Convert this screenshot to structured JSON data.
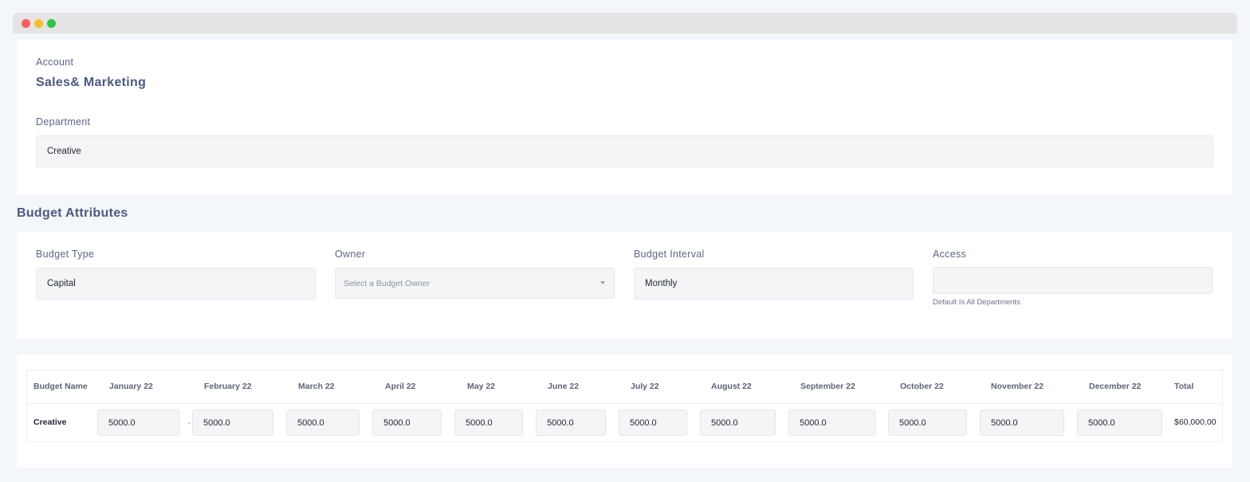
{
  "account": {
    "label": "Account",
    "value": "Sales& Marketing"
  },
  "department": {
    "label": "Department",
    "value": "Creative"
  },
  "section_title": "Budget Attributes",
  "attributes": {
    "budget_type": {
      "label": "Budget Type",
      "value": "Capital"
    },
    "owner": {
      "label": "Owner",
      "placeholder": "Select a Budget Owner"
    },
    "budget_interval": {
      "label": "Budget Interval",
      "value": "Monthly"
    },
    "access": {
      "label": "Access",
      "value": "",
      "hint": "Default Is All Departments"
    }
  },
  "table": {
    "headers": [
      "Budget Name",
      "January 22",
      "February 22",
      "March 22",
      "April 22",
      "May 22",
      "June 22",
      "July 22",
      "August 22",
      "September 22",
      "October 22",
      "November 22",
      "December 22",
      "Total"
    ],
    "row": {
      "name": "Creative",
      "months": [
        "5000.0",
        "5000.0",
        "5000.0",
        "5000.0",
        "5000.0",
        "5000.0",
        "5000.0",
        "5000.0",
        "5000.0",
        "5000.0",
        "5000.0",
        "5000.0"
      ],
      "total": "$60,000.00"
    }
  },
  "icons": {
    "owner_dropdown": "chevron-down-icon",
    "cell_dropdown": "chevron-down-icon"
  },
  "colors": {
    "page_bg": "#f3f6fa",
    "heading": "#4b5a82",
    "field_bg": "#f4f5f7"
  }
}
